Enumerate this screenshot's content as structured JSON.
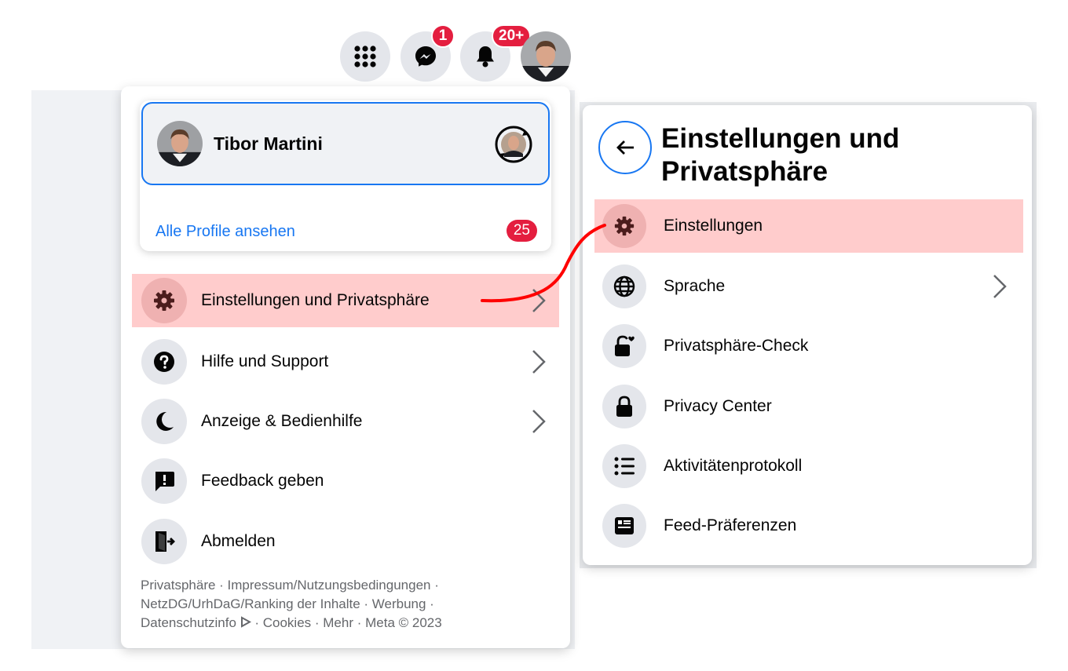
{
  "topbar": {
    "messenger_badge": "1",
    "notifications_badge": "20+"
  },
  "profile": {
    "name": "Tibor Martini",
    "all_profiles_link": "Alle Profile ansehen",
    "profiles_count": "25"
  },
  "menu": {
    "items": [
      {
        "label": "Einstellungen und Privatsphäre",
        "icon": "gear-icon",
        "has_chevron": true,
        "highlighted": true
      },
      {
        "label": "Hilfe und Support",
        "icon": "question-icon",
        "has_chevron": true
      },
      {
        "label": "Anzeige & Bedienhilfe",
        "icon": "moon-icon",
        "has_chevron": true
      },
      {
        "label": "Feedback geben",
        "icon": "feedback-icon",
        "has_chevron": false
      },
      {
        "label": "Abmelden",
        "icon": "logout-icon",
        "has_chevron": false
      }
    ]
  },
  "footer": {
    "line1": "Privatsphäre · Impressum/Nutzungsbedingungen ·",
    "line2": "NetzDG/UrhDaG/Ranking der Inhalte · Werbung ·",
    "line3a": "Datenschutzinfo",
    "line3b": " · Cookies · Mehr · Meta © 2023"
  },
  "settings_panel": {
    "title": "Einstellungen und Privatsphäre",
    "items": [
      {
        "label": "Einstellungen",
        "icon": "gear-icon",
        "highlighted": true
      },
      {
        "label": "Sprache",
        "icon": "globe-icon",
        "has_chevron": true
      },
      {
        "label": "Privatsphäre-Check",
        "icon": "lock-heart-icon"
      },
      {
        "label": "Privacy Center",
        "icon": "lock-icon"
      },
      {
        "label": "Aktivitätenprotokoll",
        "icon": "list-icon"
      },
      {
        "label": "Feed-Präferenzen",
        "icon": "feed-icon"
      }
    ]
  },
  "colors": {
    "accent": "#1877f2",
    "badge": "#e41e3f",
    "highlight": "#ffcccc",
    "annotation_arrow": "#ff0000"
  }
}
